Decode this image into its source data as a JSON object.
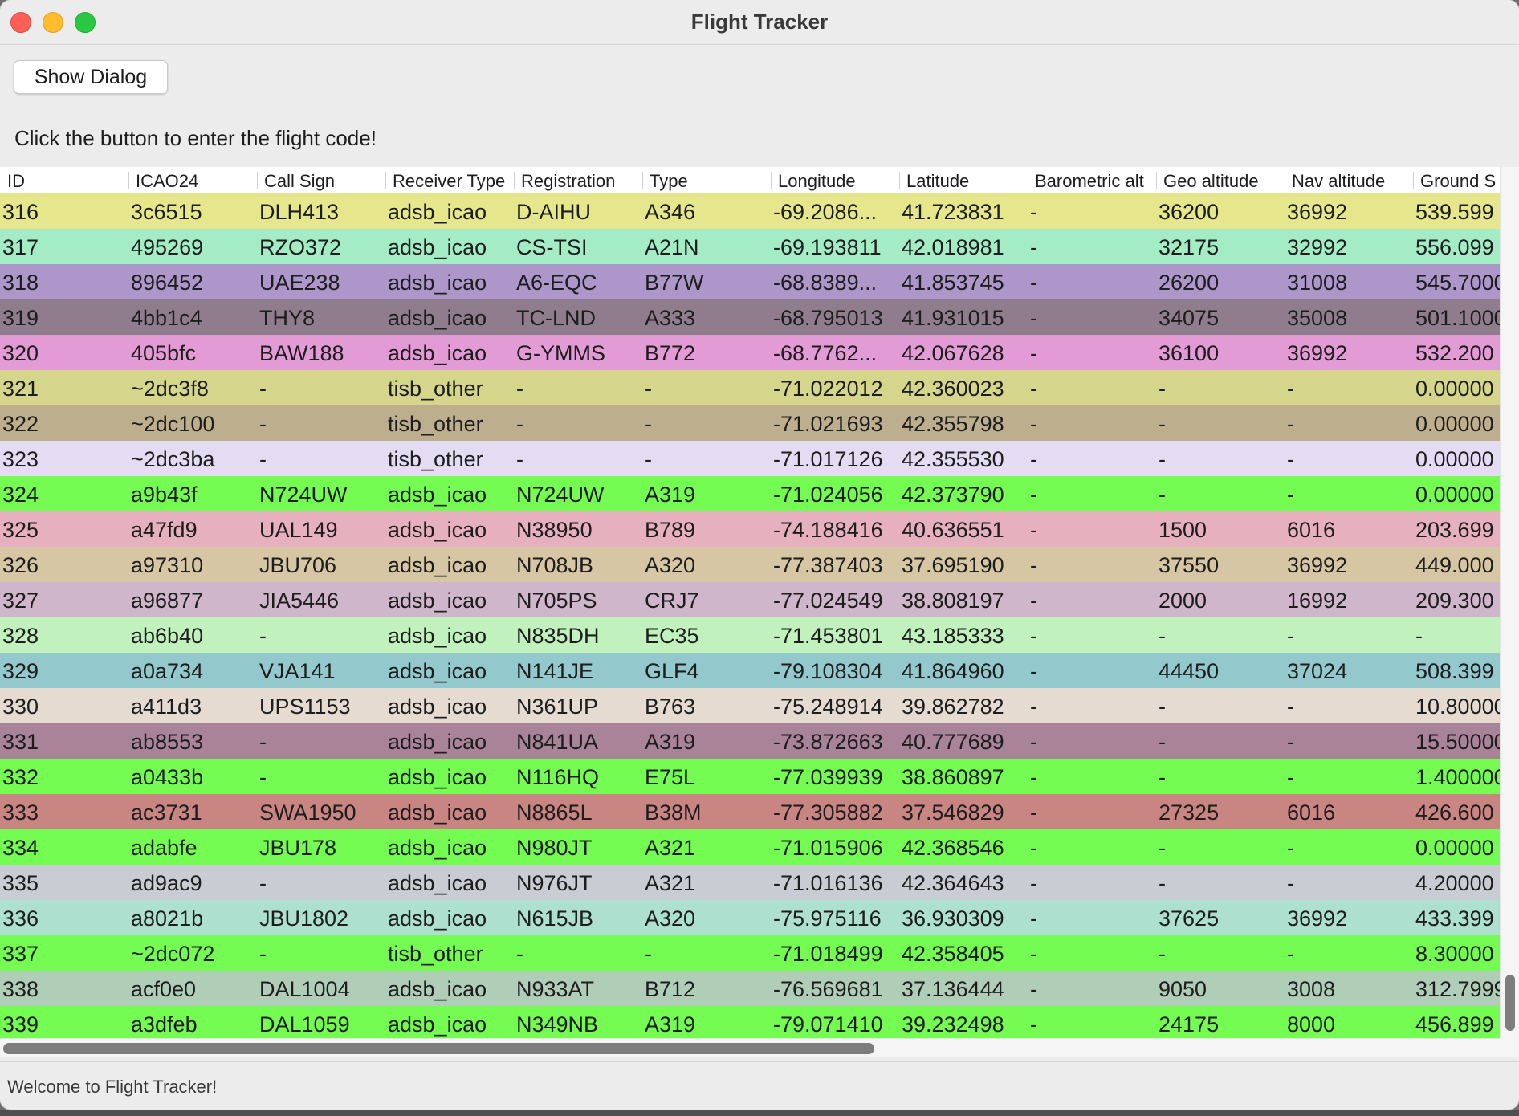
{
  "window": {
    "title": "Flight Tracker"
  },
  "toolbar": {
    "show_dialog_label": "Show Dialog"
  },
  "instruction": "Click the button to enter the flight code!",
  "status": "Welcome to Flight Tracker!",
  "table": {
    "columns": [
      "ID",
      "ICAO24",
      "Call Sign",
      "Receiver Type",
      "Registration",
      "Type",
      "Longitude",
      "Latitude",
      "Barometric alt",
      "Geo altitude",
      "Nav altitude",
      "Ground S"
    ],
    "rows": [
      {
        "color": "#e6e68c",
        "cells": [
          "316",
          "3c6515",
          "DLH413",
          "adsb_icao",
          "D-AIHU",
          "A346",
          "-69.2086...",
          "41.723831",
          "-",
          "36200",
          "36992",
          "539.599"
        ]
      },
      {
        "color": "#a3ecc6",
        "cells": [
          "317",
          "495269",
          "RZO372",
          "adsb_icao",
          "CS-TSI",
          "A21N",
          "-69.193811",
          "42.018981",
          "-",
          "32175",
          "32992",
          "556.099"
        ]
      },
      {
        "color": "#ad96c9",
        "cells": [
          "318",
          "896452",
          "UAE238",
          "adsb_icao",
          "A6-EQC",
          "B77W",
          "-68.8389...",
          "41.853745",
          "-",
          "26200",
          "31008",
          "545.7000"
        ]
      },
      {
        "color": "#8f7c8d",
        "cells": [
          "319",
          "4bb1c4",
          "THY8",
          "adsb_icao",
          "TC-LND",
          "A333",
          "-68.795013",
          "41.931015",
          "-",
          "34075",
          "35008",
          "501.1000"
        ]
      },
      {
        "color": "#e39bd6",
        "cells": [
          "320",
          "405bfc",
          "BAW188",
          "adsb_icao",
          "G-YMMS",
          "B772",
          "-68.7762...",
          "42.067628",
          "-",
          "36100",
          "36992",
          "532.200"
        ]
      },
      {
        "color": "#d5d68c",
        "cells": [
          "321",
          "~2dc3f8",
          "-",
          "tisb_other",
          "-",
          "-",
          "-71.022012",
          "42.360023",
          "-",
          "-",
          "-",
          "0.00000"
        ]
      },
      {
        "color": "#bdae8d",
        "cells": [
          "322",
          "~2dc100",
          "-",
          "tisb_other",
          "-",
          "-",
          "-71.021693",
          "42.355798",
          "-",
          "-",
          "-",
          "0.00000"
        ]
      },
      {
        "color": "#e3dcf3",
        "cells": [
          "323",
          "~2dc3ba",
          "-",
          "tisb_other",
          "-",
          "-",
          "-71.017126",
          "42.355530",
          "-",
          "-",
          "-",
          "0.00000"
        ]
      },
      {
        "color": "#75fc52",
        "cells": [
          "324",
          "a9b43f",
          "N724UW",
          "adsb_icao",
          "N724UW",
          "A319",
          "-71.024056",
          "42.373790",
          "-",
          "-",
          "-",
          "0.00000"
        ]
      },
      {
        "color": "#e6b0be",
        "cells": [
          "325",
          "a47fd9",
          "UAL149",
          "adsb_icao",
          "N38950",
          "B789",
          "-74.188416",
          "40.636551",
          "-",
          "1500",
          "6016",
          "203.699"
        ]
      },
      {
        "color": "#d7c6a3",
        "cells": [
          "326",
          "a97310",
          "JBU706",
          "adsb_icao",
          "N708JB",
          "A320",
          "-77.387403",
          "37.695190",
          "-",
          "37550",
          "36992",
          "449.000"
        ]
      },
      {
        "color": "#cfb6cb",
        "cells": [
          "327",
          "a96877",
          "JIA5446",
          "adsb_icao",
          "N705PS",
          "CRJ7",
          "-77.024549",
          "38.808197",
          "-",
          "2000",
          "16992",
          "209.300"
        ]
      },
      {
        "color": "#c1f2bd",
        "cells": [
          "328",
          "ab6b40",
          "-",
          "adsb_icao",
          "N835DH",
          "EC35",
          "-71.453801",
          "43.185333",
          "-",
          "-",
          "-",
          "-"
        ]
      },
      {
        "color": "#93c8cc",
        "cells": [
          "329",
          "a0a734",
          "VJA141",
          "adsb_icao",
          "N141JE",
          "GLF4",
          "-79.108304",
          "41.864960",
          "-",
          "44450",
          "37024",
          "508.399"
        ]
      },
      {
        "color": "#e5dbd1",
        "cells": [
          "330",
          "a411d3",
          "UPS1153",
          "adsb_icao",
          "N361UP",
          "B763",
          "-75.248914",
          "39.862782",
          "-",
          "-",
          "-",
          "10.80000"
        ]
      },
      {
        "color": "#a98499",
        "cells": [
          "331",
          "ab8553",
          "-",
          "adsb_icao",
          "N841UA",
          "A319",
          "-73.872663",
          "40.777689",
          "-",
          "-",
          "-",
          "15.50000"
        ]
      },
      {
        "color": "#75fc52",
        "cells": [
          "332",
          "a0433b",
          "-",
          "adsb_icao",
          "N116HQ",
          "E75L",
          "-77.039939",
          "38.860897",
          "-",
          "-",
          "-",
          "1.400000"
        ]
      },
      {
        "color": "#c98582",
        "cells": [
          "333",
          "ac3731",
          "SWA1950",
          "adsb_icao",
          "N8865L",
          "B38M",
          "-77.305882",
          "37.546829",
          "-",
          "27325",
          "6016",
          "426.600"
        ]
      },
      {
        "color": "#75fc52",
        "cells": [
          "334",
          "adabfe",
          "JBU178",
          "adsb_icao",
          "N980JT",
          "A321",
          "-71.015906",
          "42.368546",
          "-",
          "-",
          "-",
          "0.00000"
        ]
      },
      {
        "color": "#c9ccd3",
        "cells": [
          "335",
          "ad9ac9",
          "-",
          "adsb_icao",
          "N976JT",
          "A321",
          "-71.016136",
          "42.364643",
          "-",
          "-",
          "-",
          "4.20000"
        ]
      },
      {
        "color": "#ade0ce",
        "cells": [
          "336",
          "a8021b",
          "JBU1802",
          "adsb_icao",
          "N615JB",
          "A320",
          "-75.975116",
          "36.930309",
          "-",
          "37625",
          "36992",
          "433.399"
        ]
      },
      {
        "color": "#75fc52",
        "cells": [
          "337",
          "~2dc072",
          "-",
          "tisb_other",
          "-",
          "-",
          "-71.018499",
          "42.358405",
          "-",
          "-",
          "-",
          "8.30000"
        ]
      },
      {
        "color": "#b0cdb7",
        "cells": [
          "338",
          "acf0e0",
          "DAL1004",
          "adsb_icao",
          "N933AT",
          "B712",
          "-76.569681",
          "37.136444",
          "-",
          "9050",
          "3008",
          "312.7999"
        ]
      },
      {
        "color": "#75fc52",
        "cells": [
          "339",
          "a3dfeb",
          "DAL1059",
          "adsb_icao",
          "N349NB",
          "A319",
          "-79.071410",
          "39.232498",
          "-",
          "24175",
          "8000",
          "456.899"
        ]
      }
    ]
  }
}
